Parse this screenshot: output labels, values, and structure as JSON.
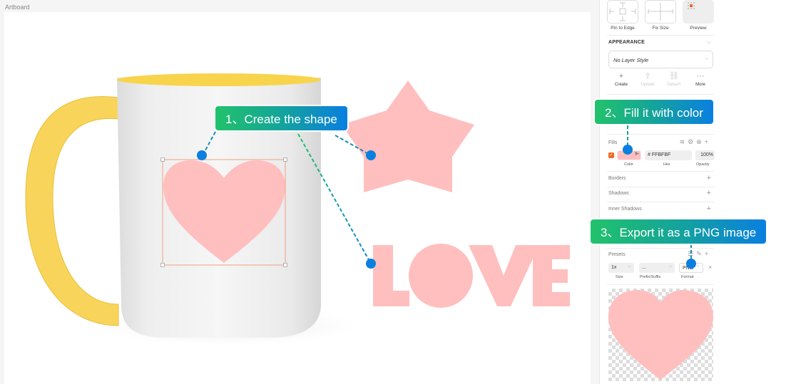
{
  "canvas": {
    "artboard_label": "Artboard",
    "love_text": "LOVE",
    "shape_fill": "#FFBFBF",
    "selection_color": "#F0A080"
  },
  "sidebar": {
    "resizing": {
      "items": [
        {
          "label": "Pin to Edge",
          "icon": "pin-to-edge-icon"
        },
        {
          "label": "Fix Size",
          "icon": "fix-size-icon"
        },
        {
          "label": "Preview",
          "icon": "preview-icon"
        }
      ]
    },
    "appearance": {
      "title": "APPEARANCE",
      "layer_style": "No Layer Style",
      "actions": [
        {
          "label": "Create",
          "icon": "plus-icon",
          "enabled": true
        },
        {
          "label": "Update",
          "icon": "update-icon",
          "enabled": false
        },
        {
          "label": "Detach",
          "icon": "detach-icon",
          "enabled": false
        },
        {
          "label": "More",
          "icon": "more-icon",
          "enabled": true
        }
      ]
    },
    "fills": {
      "title": "Fills",
      "enabled": true,
      "hex": "# FFBFBF",
      "opacity": "100%",
      "color_label": "Color",
      "hex_label": "Hex",
      "opacity_label": "Opacity"
    },
    "borders": {
      "title": "Borders"
    },
    "shadows": {
      "title": "Shadows"
    },
    "inner_shadows": {
      "title": "Inner Shadows"
    },
    "export": {
      "title": "Presets",
      "size": "1x",
      "prefix": "...",
      "format": "PNG",
      "size_label": "Size",
      "prefix_label": "Prefix/Suffix",
      "format_label": "Format"
    }
  },
  "callouts": [
    {
      "text": "1、Create the shape"
    },
    {
      "text": "2、Fill it with color"
    },
    {
      "text": "3、Export it as a PNG image"
    }
  ],
  "colors": {
    "accent_orange": "#F26722",
    "callout_start": "#22C26B",
    "callout_end": "#0A7FE0",
    "dot_blue": "#0A7FE0"
  }
}
